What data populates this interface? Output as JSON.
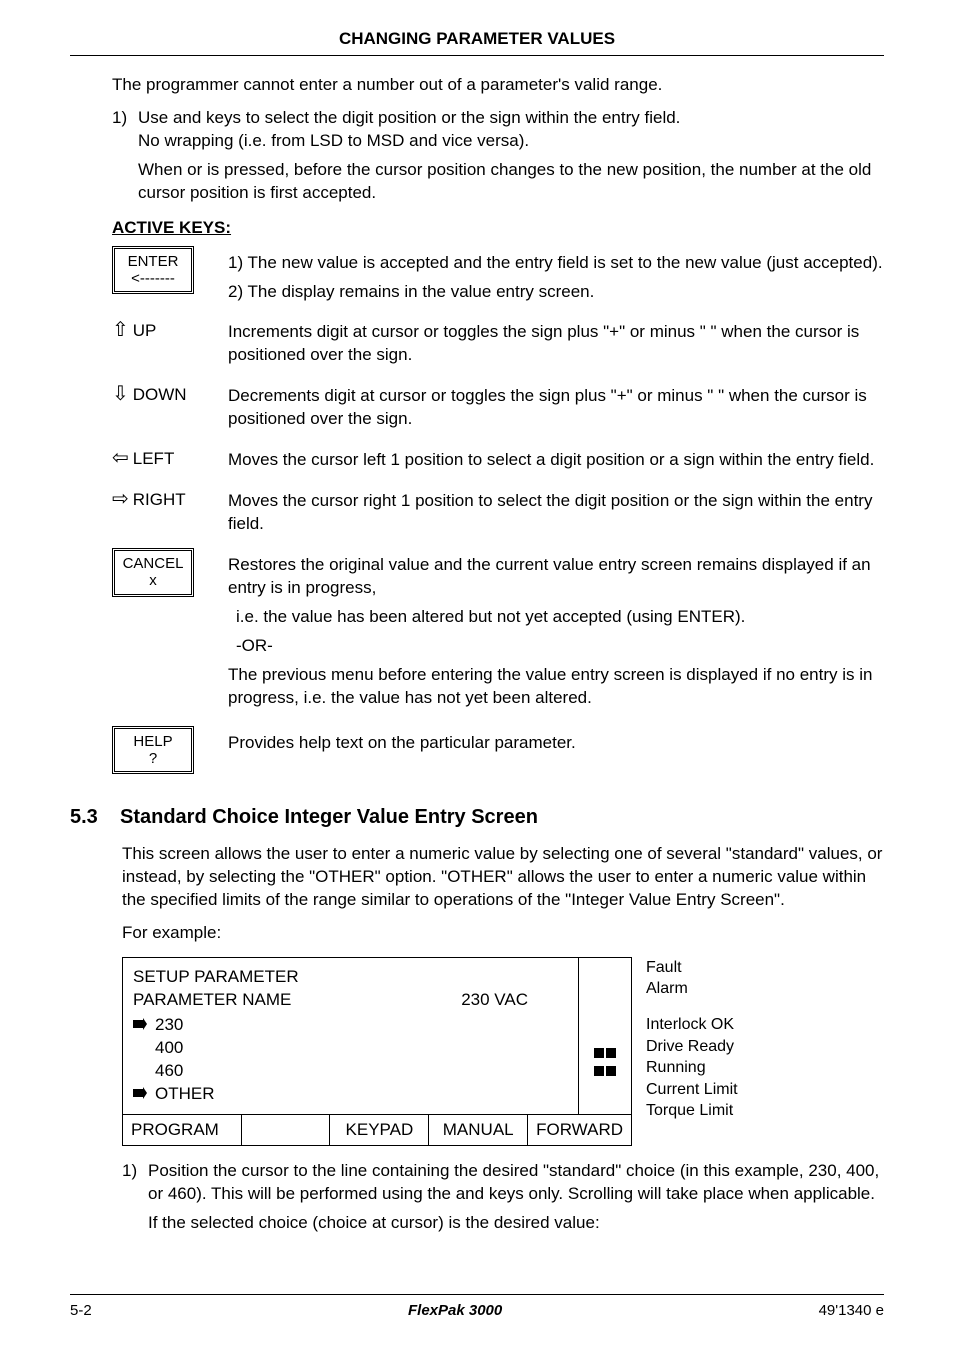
{
  "header": {
    "title": "CHANGING PARAMETER VALUES"
  },
  "intro": "The programmer cannot enter a number out of a parameter's valid range.",
  "step1": {
    "num": "1)",
    "line1": "Use    and    keys to select the digit position or the sign within the entry field.",
    "line2": "No wrapping (i.e. from LSD to MSD and vice versa).",
    "line3": "When    or    is pressed, before the cursor position changes to the new position, the number at the old cursor position is first accepted."
  },
  "active_keys_heading": "ACTIVE KEYS:",
  "keys": {
    "enter": {
      "btn_line1": "ENTER",
      "btn_line2": "<-------",
      "d1_num": "1)",
      "d1_txt": "The new value is accepted and the entry field is set to the new value (just accepted).",
      "d2_num": "2)",
      "d2_txt": "The display remains in the value entry screen."
    },
    "up": {
      "label": "UP",
      "desc": "Increments digit at cursor or toggles the sign plus \"+\" or minus \"  \" when the cursor is positioned over the sign."
    },
    "down": {
      "label": "DOWN",
      "desc": "Decrements digit at cursor or toggles the sign plus \"+\" or minus \"  \" when the cursor is positioned over the sign."
    },
    "left": {
      "label": "LEFT",
      "desc": "Moves the cursor left 1 position to select a digit position or a sign within the entry field."
    },
    "right": {
      "label": "RIGHT",
      "desc": "Moves the cursor right 1 position to select the digit position or the sign within the entry field."
    },
    "cancel": {
      "btn_line1": "CANCEL",
      "btn_line2": "x",
      "d1": "Restores the original value and the current value entry screen remains displayed if an entry is in progress,",
      "d2": "i.e. the value has been altered but not yet accepted (using ENTER).",
      "d3": "-OR-",
      "d4": "The previous menu before entering the value entry screen is displayed if no entry is in progress, i.e. the value has not yet been altered."
    },
    "help": {
      "btn_line1": "HELP",
      "btn_line2": "?",
      "desc": "Provides help text on the particular parameter."
    }
  },
  "section": {
    "num": "5.3",
    "title": "Standard Choice Integer Value Entry Screen"
  },
  "para1": "This screen allows the user to enter a numeric value by selecting one of several \"standard\" values, or instead, by selecting the \"OTHER\" option. \"OTHER\" allows the user to enter a numeric value within the specified limits of the range similar to operations of the \"Integer Value Entry Screen\".",
  "para2": "For example:",
  "lcd": {
    "line1": "SETUP PARAMETER",
    "param_name": "PARAMETER NAME",
    "param_value": "230 VAC",
    "options": [
      "230",
      "400",
      "460",
      "OTHER"
    ],
    "status_cells": [
      "PROGRAM",
      "",
      "KEYPAD",
      "MANUAL",
      "FORWARD"
    ]
  },
  "legend": {
    "items": [
      "Fault",
      "Alarm",
      "Interlock OK",
      "Drive Ready",
      "Running",
      "Current Limit",
      "Torque Limit"
    ]
  },
  "after1": {
    "num": "1)",
    "line1": "Position the cursor to the line containing the desired \"standard\" choice (in this example, 230, 400, or 460). This will be performed using the    and    keys only. Scrolling will take place when applicable.",
    "line2": "If the selected choice (choice at cursor) is the desired value:"
  },
  "footer": {
    "left": "5-2",
    "center": "FlexPak 3000",
    "right": "49'1340 e"
  }
}
